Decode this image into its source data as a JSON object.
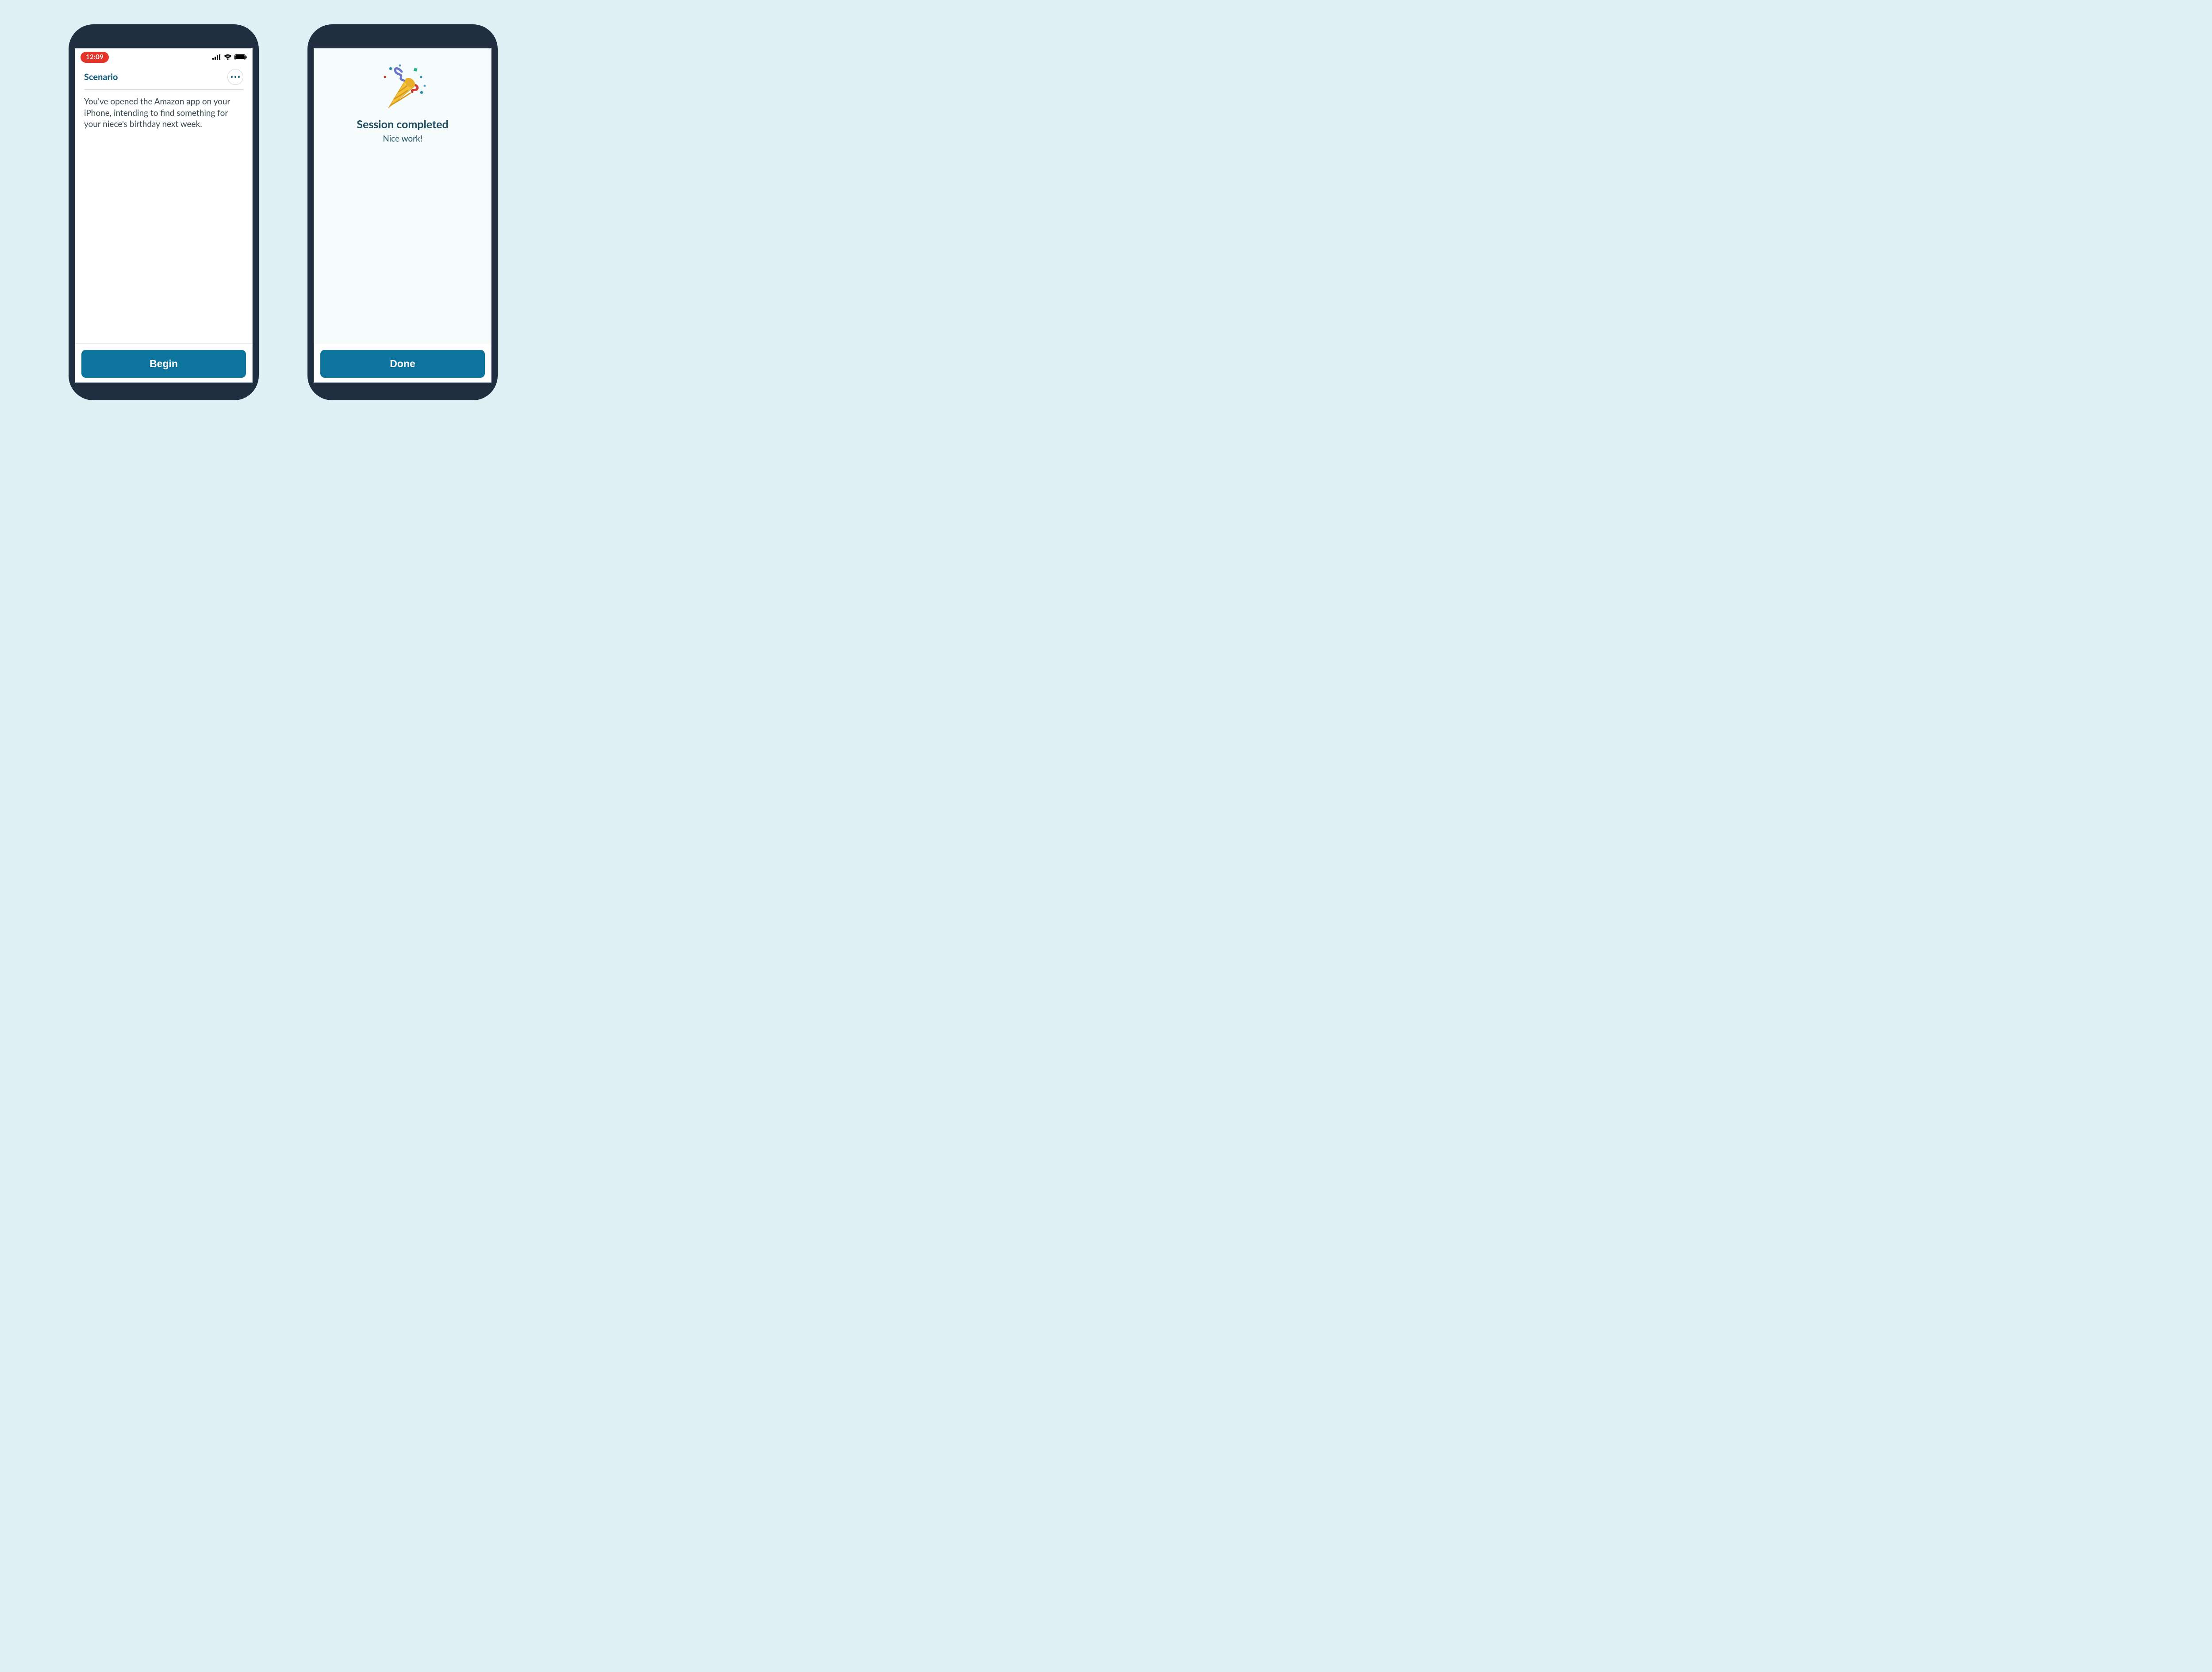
{
  "left": {
    "status": {
      "time": "12:09"
    },
    "header": {
      "title": "Scenario"
    },
    "body": "You've opened the Amazon app on your iPhone, intending to find something for your niece's birthday next week.",
    "cta": "Begin"
  },
  "right": {
    "title": "Session completed",
    "subtitle": "Nice work!",
    "cta": "Done",
    "icon": "party-popper-icon"
  },
  "colors": {
    "accent": "#0d749e",
    "frame": "#212e3f",
    "bg": "#dff1f5",
    "pill": "#e5332a"
  }
}
